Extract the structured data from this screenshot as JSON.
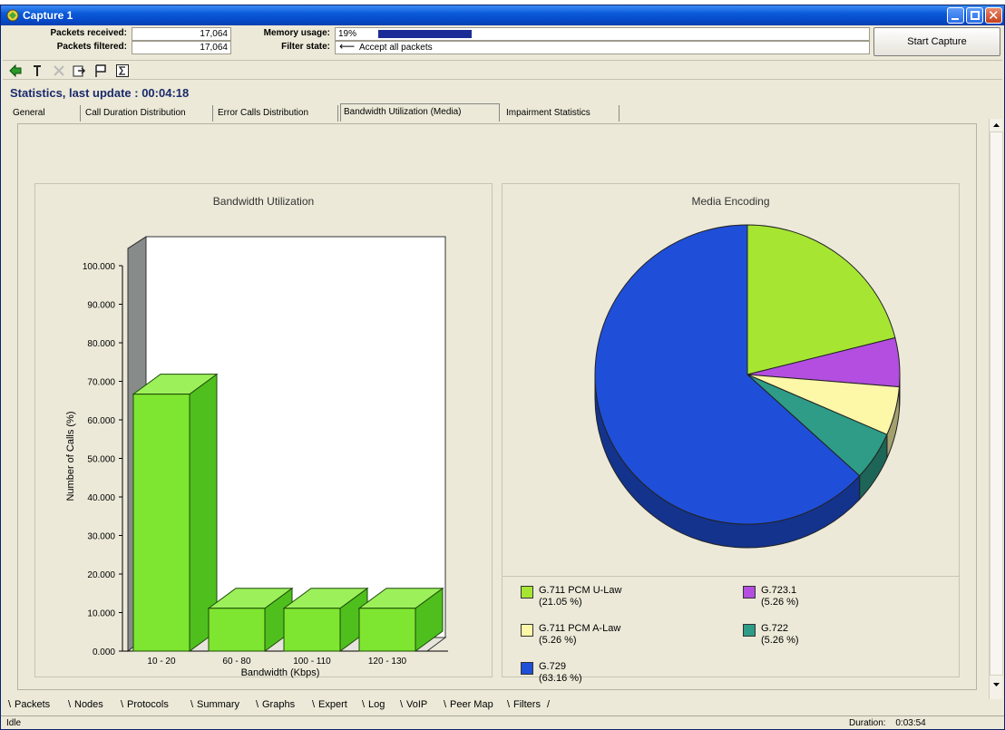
{
  "window": {
    "title": "Capture 1"
  },
  "info": {
    "packets_received_label": "Packets received:",
    "packets_received_value": "17,064",
    "packets_filtered_label": "Packets filtered:",
    "packets_filtered_value": "17,064",
    "memory_label": "Memory usage:",
    "memory_value": "19%",
    "memory_fraction": 0.19,
    "filter_label": "Filter state:",
    "filter_value": "Accept all packets"
  },
  "start_capture_label": "Start Capture",
  "toolbar": {
    "icons": [
      "back-arrow-icon",
      "filter-pin-icon",
      "disabled-icon",
      "export-icon",
      "flag-icon",
      "sum-icon"
    ]
  },
  "stats": {
    "title": "Statistics, last update : 00:04:18",
    "tabs": [
      {
        "label": "General"
      },
      {
        "label": "Call Duration Distribution"
      },
      {
        "label": "Error Calls Distribution"
      },
      {
        "label": "Bandwidth Utilization (Media)",
        "active": true
      },
      {
        "label": "Impairment Statistics"
      }
    ]
  },
  "bandwidth_chart": {
    "title": "Bandwidth Utilization",
    "ylabel": "Number of Calls (%)",
    "xlabel": "Bandwidth (Kbps)"
  },
  "media_chart": {
    "title": "Media Encoding"
  },
  "chart_data": [
    {
      "type": "bar",
      "title": "Bandwidth Utilization",
      "xlabel": "Bandwidth (Kbps)",
      "ylabel": "Number of Calls (%)",
      "categories": [
        "10 - 20",
        "60 - 80",
        "100 - 110",
        "120 - 130"
      ],
      "values": [
        66.67,
        11.11,
        11.11,
        11.11
      ],
      "ylim": [
        0,
        100
      ],
      "yticks": [
        "0.000",
        "10.000",
        "20.000",
        "30.000",
        "40.000",
        "50.000",
        "60.000",
        "70.000",
        "80.000",
        "90.000",
        "100.000"
      ],
      "color": "#7ee630",
      "grid": false
    },
    {
      "type": "pie",
      "title": "Media Encoding",
      "slices": [
        {
          "name": "G.711 PCM U-Law",
          "pct_label": "(21.05 %)",
          "value": 21.05,
          "color": "#a6e632"
        },
        {
          "name": "G.723.1",
          "pct_label": "(5.26 %)",
          "value": 5.26,
          "color": "#b34ee0"
        },
        {
          "name": "G.711 PCM A-Law",
          "pct_label": "(5.26 %)",
          "value": 5.26,
          "color": "#fdf7a8"
        },
        {
          "name": "G.722",
          "pct_label": "(5.26 %)",
          "value": 5.26,
          "color": "#2e9c86"
        },
        {
          "name": "G.729",
          "pct_label": "(63.16 %)",
          "value": 63.16,
          "color": "#1f4fd8"
        }
      ],
      "legend_position": "bottom"
    }
  ],
  "bottom_tabs": [
    "Packets",
    "Nodes",
    "Protocols",
    "Summary",
    "Graphs",
    "Expert",
    "Log",
    "VoIP",
    "Peer Map",
    "Filters"
  ],
  "status": {
    "state": "Idle",
    "duration_label": "Duration:",
    "duration_value": "0:03:54"
  }
}
